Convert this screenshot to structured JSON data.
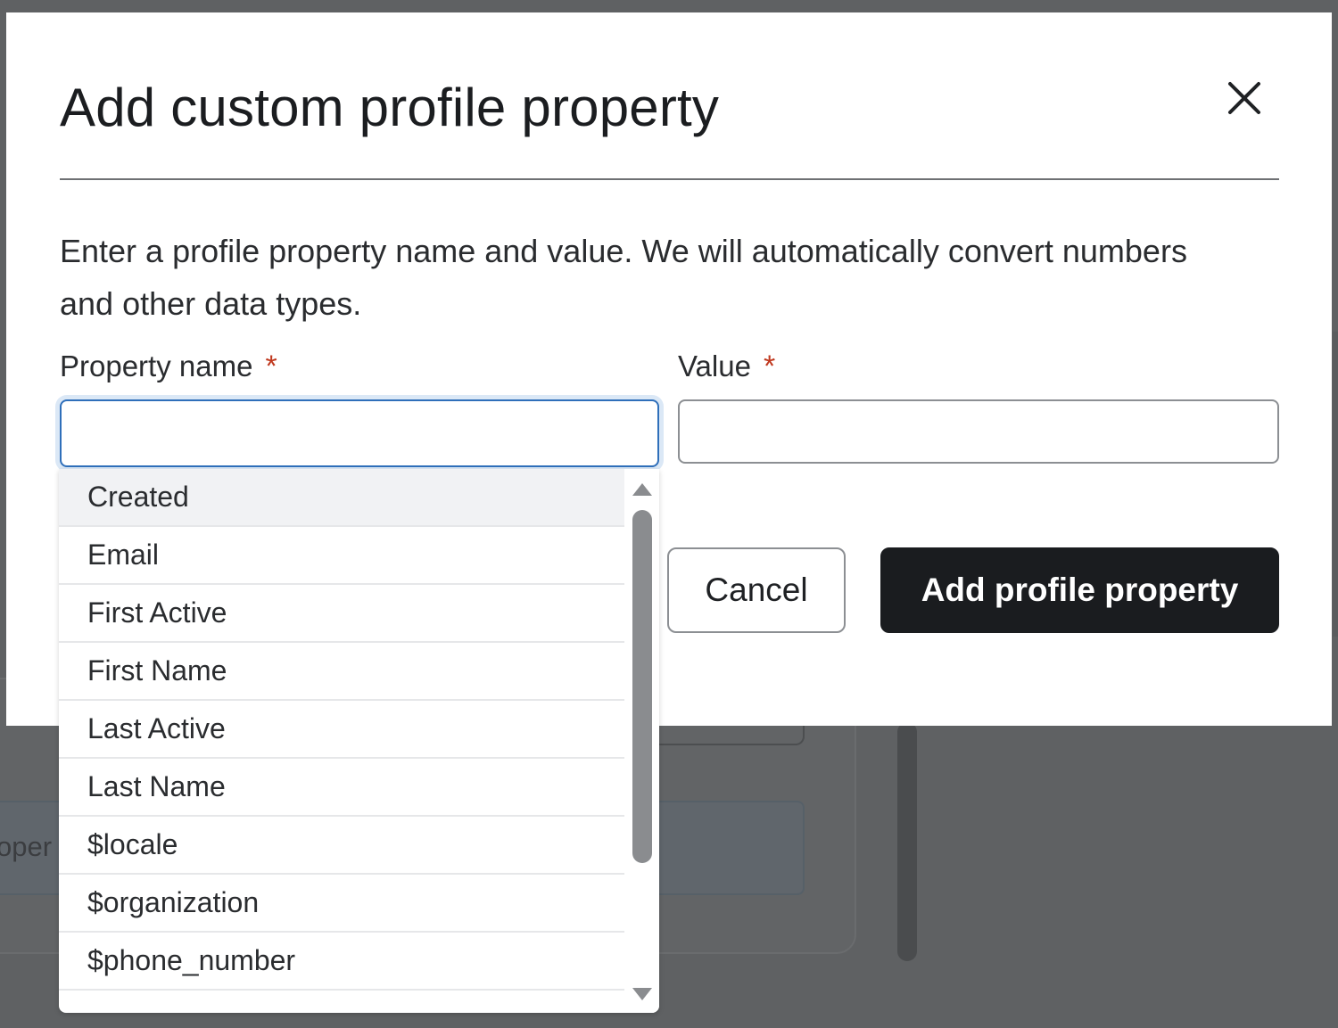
{
  "background": {
    "partial_text": "oper"
  },
  "modal": {
    "title": "Add custom profile property",
    "close_icon": "close-icon",
    "description": "Enter a profile property name and value. We will automatically convert numbers and other data types.",
    "property_name": {
      "label": "Property name",
      "required_mark": "*",
      "value": ""
    },
    "value_field": {
      "label": "Value",
      "required_mark": "*",
      "value": ""
    },
    "cancel_label": "Cancel",
    "submit_label": "Add profile property"
  },
  "dropdown": {
    "options": [
      "Created",
      "Email",
      "First Active",
      "First Name",
      "Last Active",
      "Last Name",
      "$locale",
      "$organization",
      "$phone_number"
    ],
    "highlighted_index": 0
  },
  "colors": {
    "primary_button": "#1a1c1f",
    "focus_border": "#2f6fba",
    "required_asterisk": "#c0391f",
    "overlay": "#5f6163"
  }
}
